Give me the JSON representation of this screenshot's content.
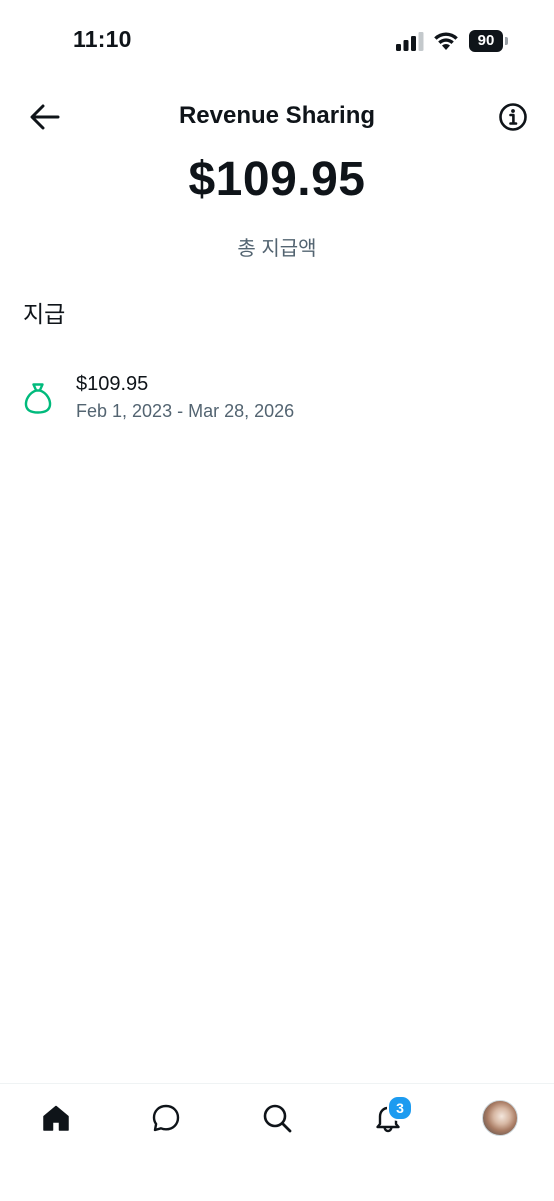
{
  "status_bar": {
    "time": "11:10",
    "battery_level": "90",
    "icons": [
      "signal-icon",
      "wifi-icon",
      "battery-icon"
    ]
  },
  "header": {
    "title": "Revenue Sharing",
    "back_icon": "arrow-left-icon",
    "info_icon": "info-circle-icon"
  },
  "summary": {
    "total_amount": "$109.95",
    "total_label": "총 지급액"
  },
  "payouts": {
    "section_title": "지급",
    "items": [
      {
        "icon": "moneybag-icon",
        "amount": "$109.95",
        "date_range": "Feb 1, 2023 - Mar 28, 2026"
      }
    ]
  },
  "bottom_nav": {
    "items": [
      {
        "icon": "home-icon",
        "active": true
      },
      {
        "icon": "messages-icon",
        "active": false
      },
      {
        "icon": "search-icon",
        "active": false
      },
      {
        "icon": "notifications-icon",
        "active": false,
        "badge": "3"
      },
      {
        "icon": "profile-avatar",
        "active": false
      }
    ]
  },
  "colors": {
    "text_primary": "#0f1419",
    "text_secondary": "#536471",
    "accent_green": "#00ba7c",
    "badge_blue": "#1d9bf0"
  }
}
